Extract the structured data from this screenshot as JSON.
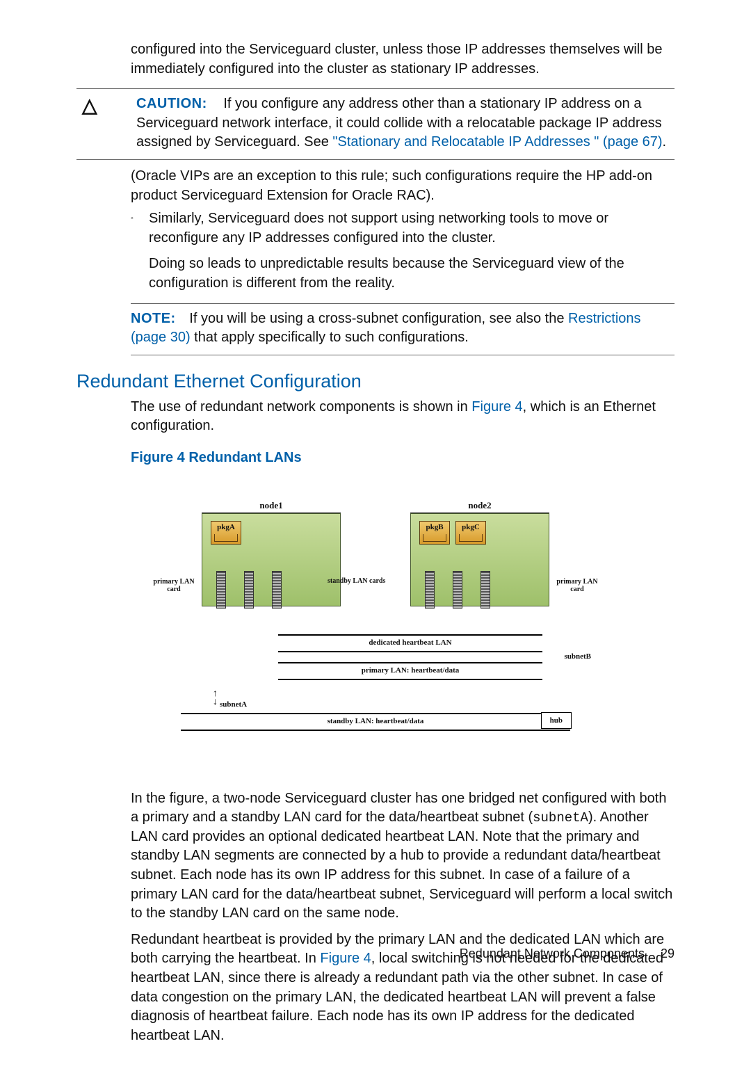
{
  "intro": "configured into the Serviceguard cluster, unless those IP addresses themselves will be immediately configured into the cluster as stationary IP addresses.",
  "caution": {
    "label": "CAUTION:",
    "body_pre": "If you configure any address other than a stationary IP address on a Serviceguard network interface, it could collide with a relocatable package IP address assigned by Serviceguard. See ",
    "link": "\"Stationary and Relocatable IP Addresses \" (page 67)",
    "body_post": "."
  },
  "oracle": "(Oracle VIPs are an exception to this rule; such configurations require the HP add-on product Serviceguard Extension for Oracle RAC).",
  "bullet": {
    "p1": "Similarly, Serviceguard does not support using networking tools to move or reconfigure any IP addresses configured into the cluster.",
    "p2": "Doing so leads to unpredictable results because the Serviceguard view of the configuration is different from the reality."
  },
  "note": {
    "label": "NOTE:",
    "pre": "If you will be using a cross-subnet configuration, see also the ",
    "link": "Restrictions (page 30)",
    "post": " that apply specifically to such configurations."
  },
  "h2": "Redundant Ethernet Configuration",
  "sec_intro_pre": "The use of redundant network components is shown in ",
  "sec_intro_link": "Figure 4",
  "sec_intro_post": ", which is an Ethernet configuration.",
  "fig_caption": "Figure 4 Redundant LANs",
  "diagram": {
    "node1": "node1",
    "node2": "node2",
    "pkgA": "pkgA",
    "pkgB": "pkgB",
    "pkgC": "pkgC",
    "primary_left": "primary LAN card",
    "standby": "standby LAN cards",
    "primary_right": "primary LAN card",
    "lan1": "dedicated heartbeat LAN",
    "lan2": "primary LAN: heartbeat/data",
    "lan3": "standby LAN: heartbeat/data",
    "subnetA": "subnetA",
    "subnetB": "subnetB",
    "hub": "hub"
  },
  "body1_pre": "In the figure, a two-node Serviceguard cluster has one bridged net configured with both a primary and a standby LAN card for the data/heartbeat subnet (",
  "body1_code": "subnetA",
  "body1_post": "). Another LAN card provides an optional dedicated heartbeat LAN. Note that the primary and standby LAN segments are connected by a hub to provide a redundant data/heartbeat subnet. Each node has its own IP address for this subnet. In case of a failure of a primary LAN card for the data/heartbeat subnet, Serviceguard will perform a local switch to the standby LAN card on the same node.",
  "body2_pre": "Redundant heartbeat is provided by the primary LAN and the dedicated LAN which are both carrying the heartbeat. In ",
  "body2_link": "Figure 4",
  "body2_post": ", local switching is not needed for the dedicated heartbeat LAN, since there is already a redundant path via the other subnet. In case of data congestion on the primary LAN, the dedicated heartbeat LAN will prevent a false diagnosis of heartbeat failure. Each node has its own IP address for the dedicated heartbeat LAN.",
  "footer_text": "Redundant Network Components",
  "page_number": "29"
}
